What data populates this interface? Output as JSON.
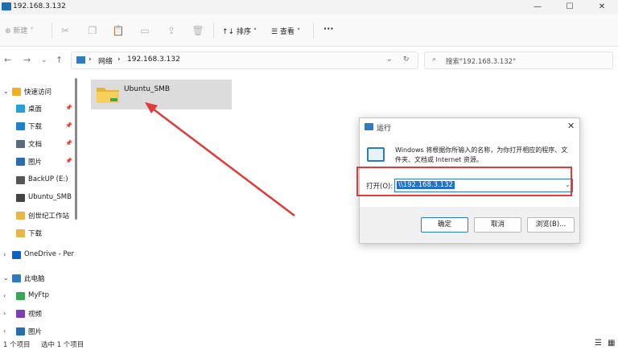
{
  "window": {
    "title": "192.168.3.132",
    "minimize": "—",
    "maximize": "☐",
    "close": "✕"
  },
  "toolbar": {
    "new_label": "⊕ 新建 ˅",
    "sort_label": "↑↓ 排序 ˅",
    "view_label": "☰ 查看 ˅",
    "more": "···"
  },
  "address": {
    "separator1": "›",
    "crumb1": "网络",
    "separator2": "›",
    "crumb2": "192.168.3.132",
    "dropdown": "⌄",
    "refresh": "↻",
    "search_placeholder": "搜索\"192.168.3.132\""
  },
  "nav": {
    "back": "←",
    "forward": "→",
    "down": "⌄",
    "up": "↑"
  },
  "sidebar": {
    "items": [
      {
        "label": "快速访问",
        "chev": "⌄",
        "color": "#f2b01e"
      },
      {
        "label": "桌面",
        "chev": "",
        "color": "#2a9fd6",
        "pin": "📌"
      },
      {
        "label": "下载",
        "chev": "",
        "color": "#1f7fc8",
        "pin": "📌"
      },
      {
        "label": "文档",
        "chev": "",
        "color": "#5a6b7b",
        "pin": "📌"
      },
      {
        "label": "图片",
        "chev": "",
        "color": "#2b6cb0",
        "pin": "📌"
      },
      {
        "label": "BackUP (E:)",
        "chev": "",
        "color": "#555555"
      },
      {
        "label": "Ubuntu_SMB (",
        "chev": "",
        "color": "#444444"
      },
      {
        "label": "创世纪工作站",
        "chev": "",
        "color": "#e7b74a"
      },
      {
        "label": "下载",
        "chev": "",
        "color": "#e7b74a"
      },
      {
        "label": "OneDrive - Per",
        "chev": "›",
        "color": "#0a64c8"
      },
      {
        "label": "此电脑",
        "chev": "⌄",
        "color": "#2a7dc2"
      },
      {
        "label": "MyFtp",
        "chev": "›",
        "color": "#3aa655"
      },
      {
        "label": "视频",
        "chev": "›",
        "color": "#7a3fb5"
      },
      {
        "label": "图片",
        "chev": "›",
        "color": "#2b6cb0"
      }
    ]
  },
  "content": {
    "folder_name": "Ubuntu_SMB"
  },
  "status": {
    "count": "1 个项目",
    "selected": "选中 1 个项目"
  },
  "run_dialog": {
    "title": "运行",
    "close": "✕",
    "description": "Windows 将根据你所输入的名称，为你打开相应的程序、文件夹、文档或 Internet 资源。",
    "open_label": "打开(O):",
    "input_value": "\\\\192.168.3.132",
    "ok": "确定",
    "cancel": "取消",
    "browse": "浏览(B)..."
  },
  "colors": {
    "accent": "#2a7dc2",
    "annotation_red": "#e03a3a",
    "folder_yellow": "#f5c542"
  }
}
